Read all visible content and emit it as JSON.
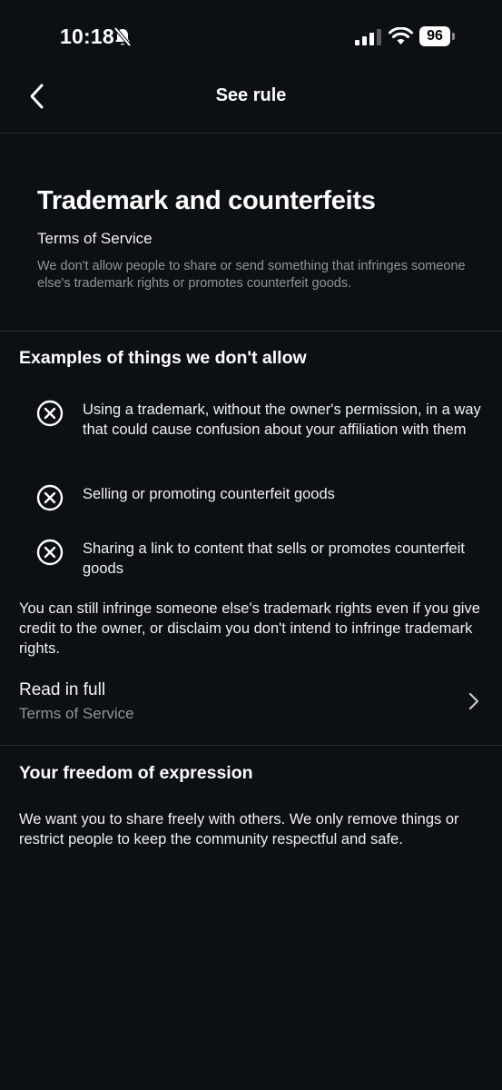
{
  "status_bar": {
    "time": "10:18",
    "battery": "96",
    "icons": [
      "bell-slash-icon",
      "cellular-signal-icon",
      "wifi-icon",
      "battery-icon"
    ]
  },
  "nav": {
    "title": "See rule",
    "back_icon": "chevron-left-icon"
  },
  "rule": {
    "title": "Trademark and counterfeits",
    "subtitle": "Terms of Service",
    "description": "We don't allow people to share or send something that infringes someone else's trademark rights or promotes counterfeit goods."
  },
  "examples": {
    "heading": "Examples of things we don't allow",
    "icon": "x-circle-icon",
    "items": [
      "Using a trademark, without the owner's permission, in a way that could cause confusion about your affiliation with them",
      "Selling or promoting counterfeit goods",
      "Sharing a link to content that sells or promotes counterfeit goods"
    ],
    "note": "You can still infringe someone else's trademark rights even if you give credit to the owner, or disclaim you don't intend to infringe trademark rights."
  },
  "read_full": {
    "label": "Read in full",
    "sublabel": "Terms of Service",
    "icon": "chevron-right-icon"
  },
  "freedom": {
    "heading": "Your freedom of expression",
    "text": "We want you to share freely with others. We only remove things or restrict people to keep the community respectful and safe."
  },
  "colors": {
    "background": "#0c1014",
    "secondary_text": "#8e9499",
    "divider": "#262a2f"
  }
}
